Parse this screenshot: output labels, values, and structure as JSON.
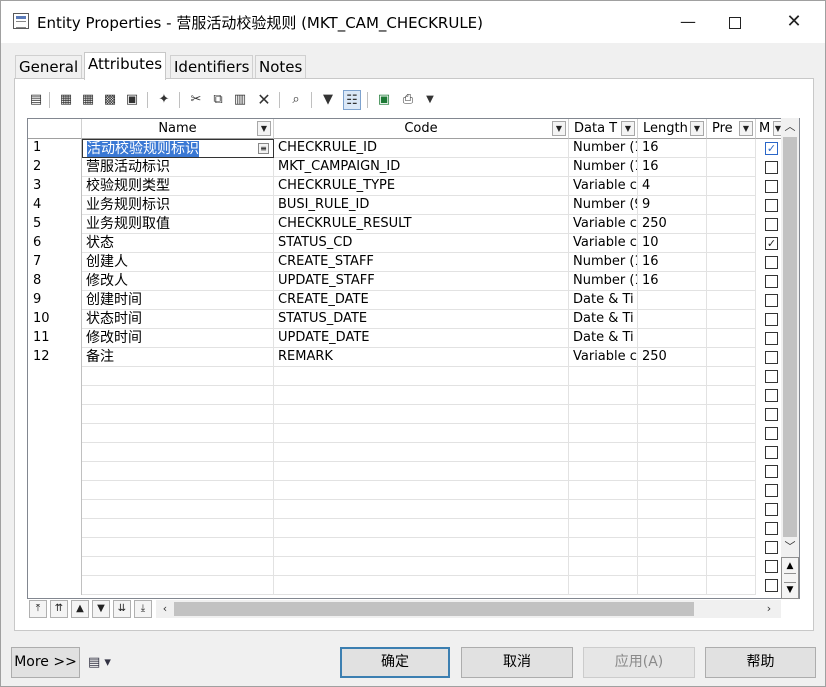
{
  "window": {
    "title": "Entity Properties - 营服活动校验规则 (MKT_CAM_CHECKRULE)",
    "minimize": "—",
    "close": "✕"
  },
  "tabs": [
    "General",
    "Attributes",
    "Identifiers",
    "Notes"
  ],
  "active_tab": "Attributes",
  "toolbar_icons": [
    "properties-icon",
    "insert-row-icon",
    "add-row-icon",
    "add-attributes-icon",
    "replicate-icon",
    "new-domain-icon",
    "cut-icon",
    "copy-icon",
    "paste-icon",
    "delete-icon",
    "find-icon",
    "filter-icon",
    "customize-columns-icon",
    "export-excel-icon",
    "print-icon",
    "dropdown-icon"
  ],
  "grid": {
    "columns": [
      "Name",
      "Code",
      "Data T",
      "Length",
      "Pre",
      "M"
    ],
    "rows": [
      {
        "num": "1",
        "name": "活动校验规则标识",
        "code": "CHECKRULE_ID",
        "type": "Number (1",
        "length": "16",
        "pre": "",
        "m": true
      },
      {
        "num": "2",
        "name": "营服活动标识",
        "code": "MKT_CAMPAIGN_ID",
        "type": "Number (1",
        "length": "16",
        "pre": "",
        "m": false
      },
      {
        "num": "3",
        "name": "校验规则类型",
        "code": "CHECKRULE_TYPE",
        "type": "Variable c",
        "length": "4",
        "pre": "",
        "m": false
      },
      {
        "num": "4",
        "name": "业务规则标识",
        "code": "BUSI_RULE_ID",
        "type": "Number (9",
        "length": "9",
        "pre": "",
        "m": false
      },
      {
        "num": "5",
        "name": "业务规则取值",
        "code": "CHECKRULE_RESULT",
        "type": "Variable c",
        "length": "250",
        "pre": "",
        "m": false
      },
      {
        "num": "6",
        "name": "状态",
        "code": "STATUS_CD",
        "type": "Variable c",
        "length": "10",
        "pre": "",
        "m": true
      },
      {
        "num": "7",
        "name": "创建人",
        "code": "CREATE_STAFF",
        "type": "Number (1",
        "length": "16",
        "pre": "",
        "m": false
      },
      {
        "num": "8",
        "name": "修改人",
        "code": "UPDATE_STAFF",
        "type": "Number (1",
        "length": "16",
        "pre": "",
        "m": false
      },
      {
        "num": "9",
        "name": "创建时间",
        "code": "CREATE_DATE",
        "type": "Date & Ti",
        "length": "",
        "pre": "",
        "m": false
      },
      {
        "num": "10",
        "name": "状态时间",
        "code": "STATUS_DATE",
        "type": "Date & Ti",
        "length": "",
        "pre": "",
        "m": false
      },
      {
        "num": "11",
        "name": "修改时间",
        "code": "UPDATE_DATE",
        "type": "Date & Ti",
        "length": "",
        "pre": "",
        "m": false
      },
      {
        "num": "12",
        "name": "备注",
        "code": "REMARK",
        "type": "Variable c",
        "length": "250",
        "pre": "",
        "m": false
      }
    ],
    "empty_rows": 12
  },
  "nav_buttons": [
    "⤒",
    "⇈",
    "▲",
    "▼",
    "⇊",
    "⤓"
  ],
  "buttons": {
    "more": "More >>",
    "ok": "确定",
    "cancel": "取消",
    "apply": "应用(A)",
    "help": "帮助"
  }
}
